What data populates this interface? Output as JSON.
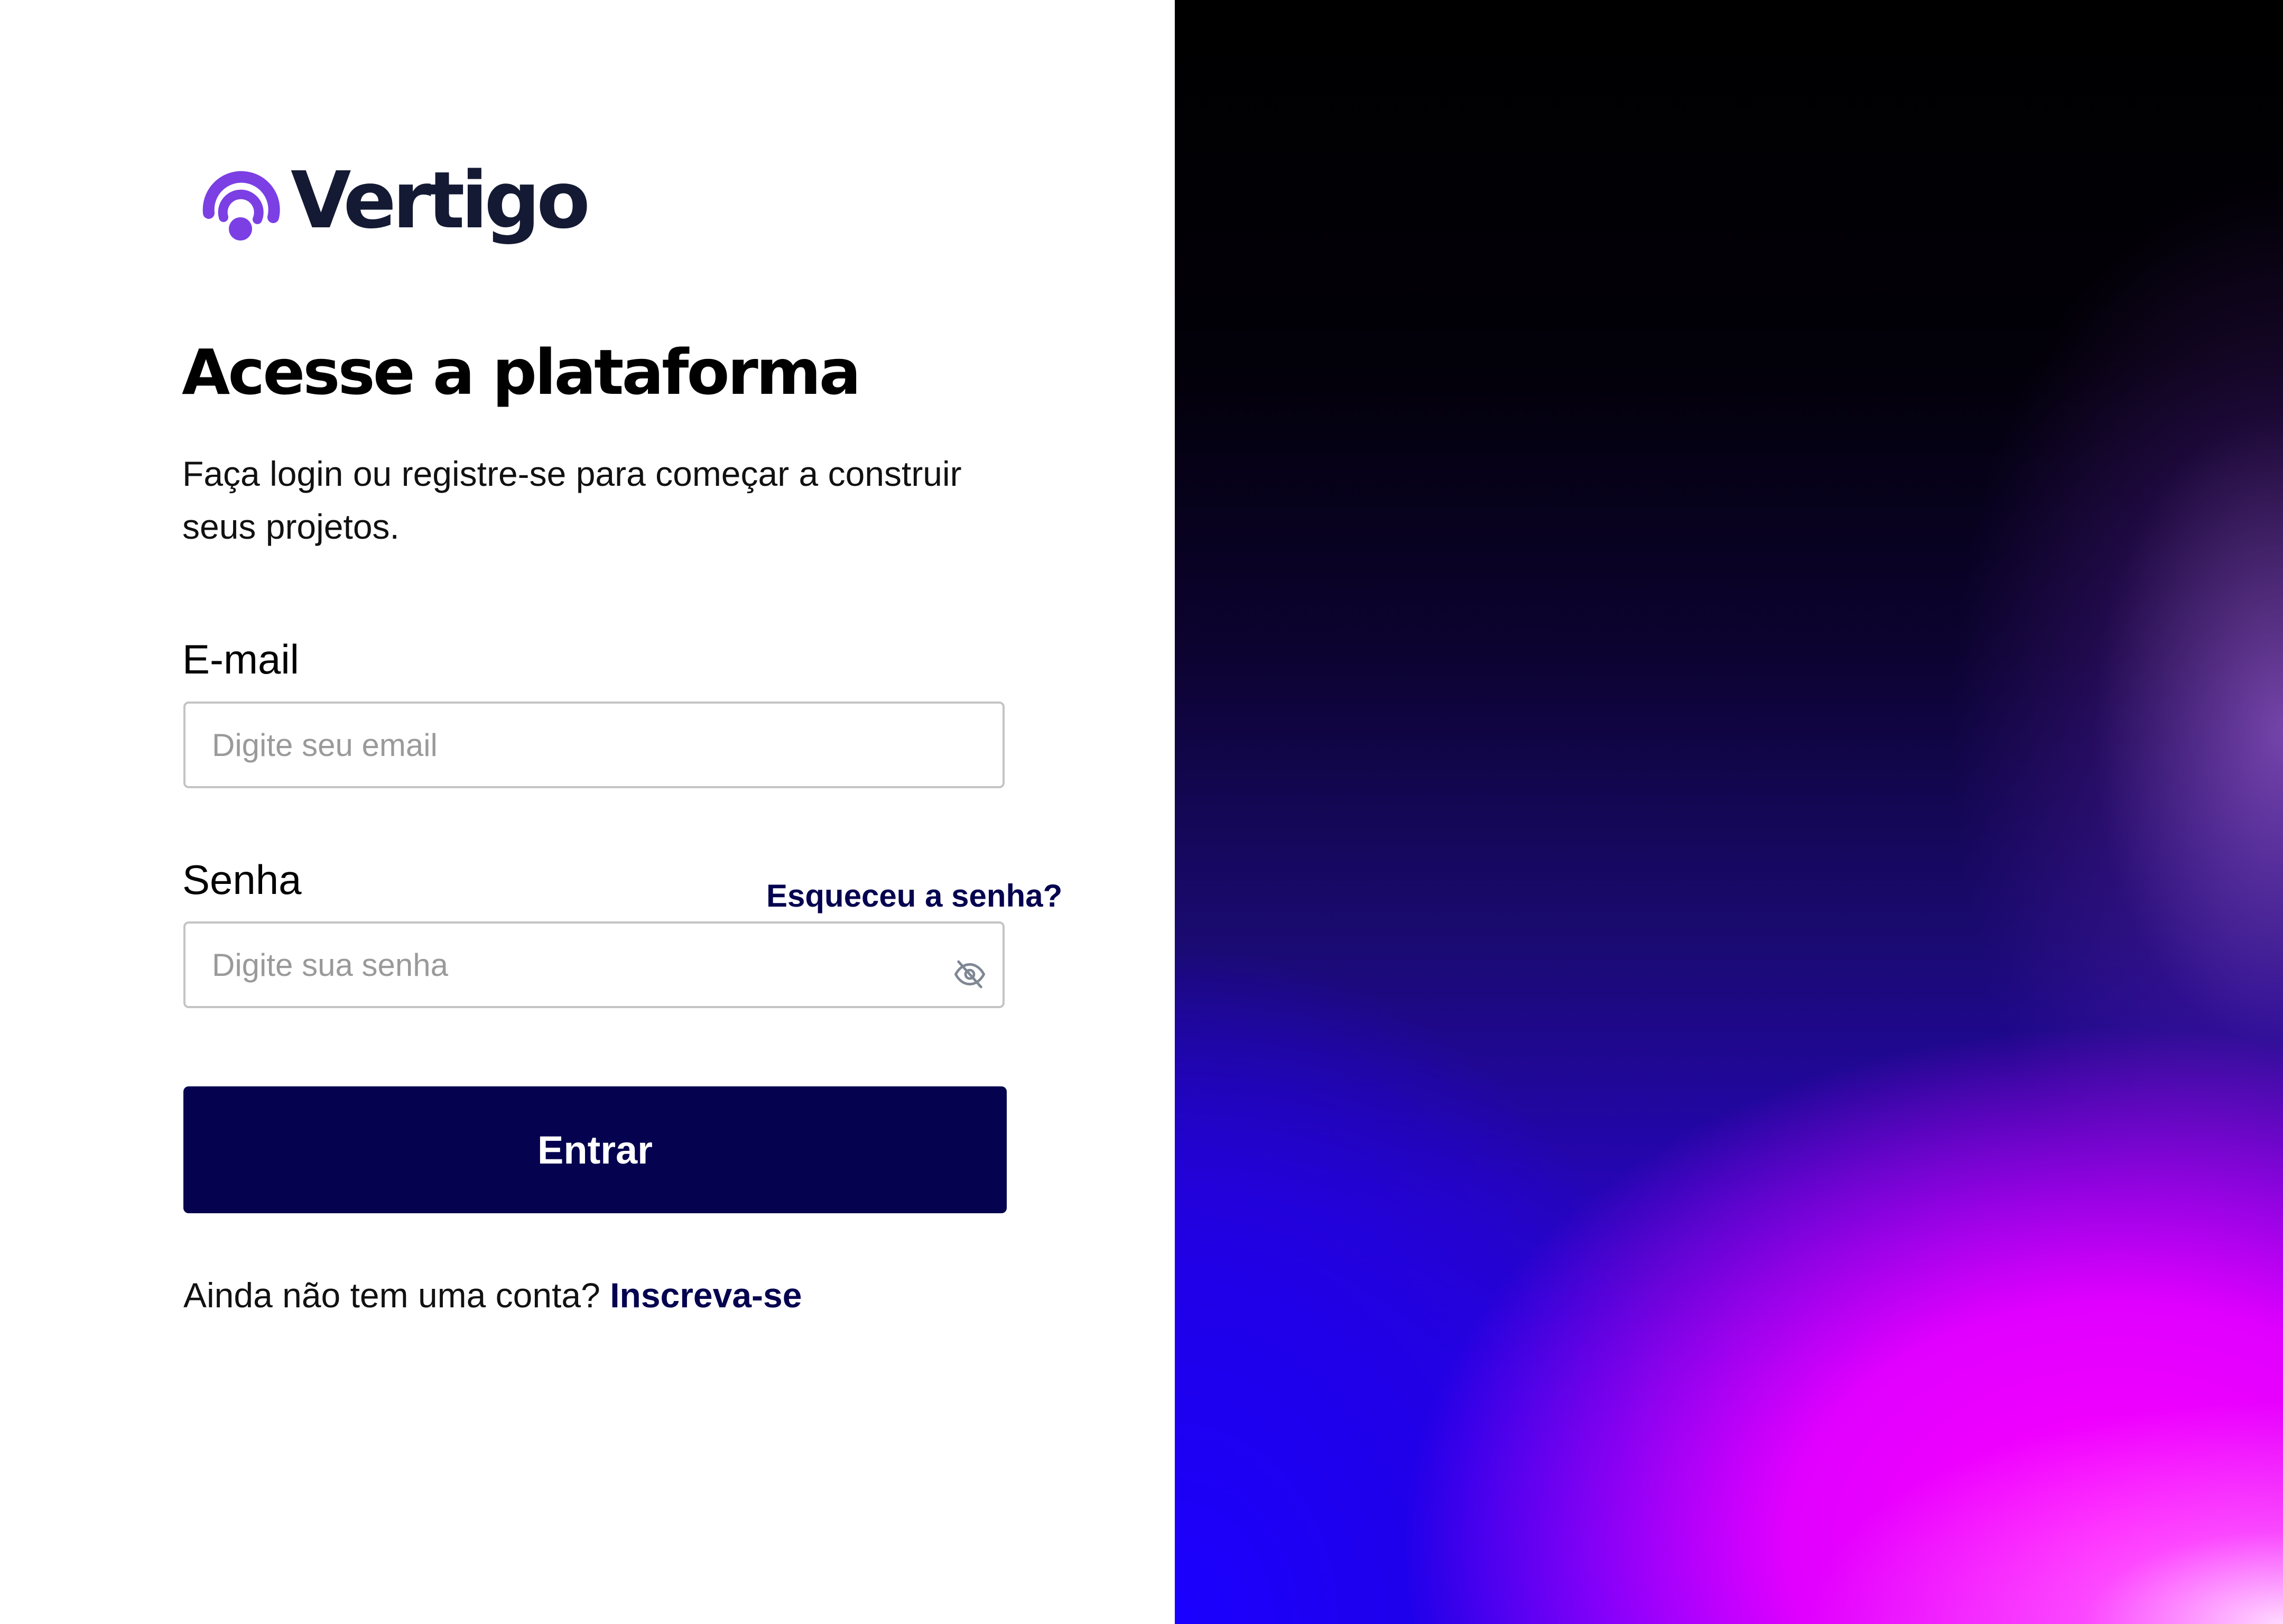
{
  "brand": {
    "name": "Vertigo",
    "accent_color": "#7b3fe4",
    "text_color": "#141a33"
  },
  "login": {
    "headline": "Acesse a plataforma",
    "subtitle": "Faça login ou registre-se para começar a construir seus projetos.",
    "email": {
      "label": "E-mail",
      "placeholder": "Digite seu email",
      "value": ""
    },
    "password": {
      "label": "Senha",
      "placeholder": "Digite sua senha",
      "value": "",
      "toggle_icon": "eye-off-icon"
    },
    "forgot_link": "Esqueceu a senha?",
    "submit_label": "Entrar",
    "signup_prompt": "Ainda não tem uma conta?",
    "signup_link": "Inscreva-se"
  },
  "colors": {
    "primary": "#05034f",
    "input_border": "#c4c4c4",
    "placeholder": "#9a9a9a"
  }
}
